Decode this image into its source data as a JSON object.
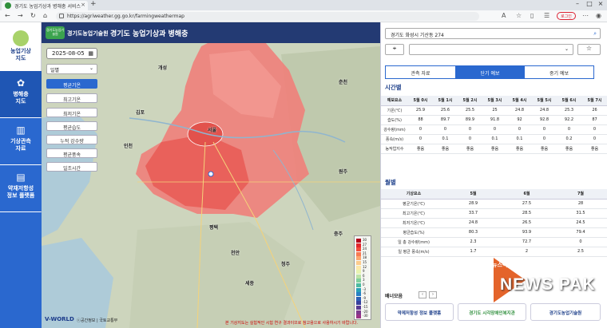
{
  "browser": {
    "tab_title": "경기도 농업기상과 병해충 서비스",
    "url": "https://agriweather.gg.go.kr/farmingweathermap",
    "profile_label": "로그인"
  },
  "leftnav": {
    "logo_label": "농업기상\n지도",
    "items": [
      {
        "label": "병해충\n지도",
        "icon": "bug-icon"
      },
      {
        "label": "기상관측\n자료",
        "icon": "chart-icon"
      },
      {
        "label": "약재저항성\n정보 플랫폼",
        "icon": "device-icon"
      }
    ]
  },
  "map": {
    "header_org": "경기도농업기술원",
    "header_title": "경기도 농업기상과 병해충",
    "badge_text": "경기도농업기술원",
    "date": "2025-08-05",
    "select_value": "일별",
    "variables": [
      "평균기온",
      "최고기온",
      "최저기온",
      "평균습도",
      "누적 강수량",
      "평균풍속",
      "일조시간"
    ],
    "active_variable": 0,
    "places": [
      "개성",
      "김포",
      "서울",
      "인천",
      "평택",
      "천안",
      "세종",
      "춘천",
      "원주",
      "충주",
      "청주"
    ],
    "legend": {
      "values": [
        "30",
        "27",
        "24",
        "21",
        "18",
        "15",
        "12",
        "9",
        "6",
        "3",
        "0",
        "-3",
        "-6",
        "-9",
        "-12",
        "-15",
        "-20",
        "-30"
      ],
      "colors": [
        "#b3001b",
        "#e3262d",
        "#f24d3c",
        "#f87a53",
        "#fda66f",
        "#fecc8c",
        "#fee8a8",
        "#e8f3b0",
        "#bde3a6",
        "#82cf9e",
        "#4dbba0",
        "#2aa1b7",
        "#2881c4",
        "#2e60b5",
        "#37409e",
        "#5a3b92",
        "#7c3a8d",
        "#9a3286"
      ]
    },
    "logo": "V-WORLD",
    "copyright": "ⓒ공간정보 | 국토교통부",
    "disclaimer": "본 기상지도는 실험적인 시험 연구 결과이므로 참고용으로 사용하시기 바랍니다."
  },
  "panel": {
    "search_value": "경기도 화성시 기산동 274",
    "tabs": [
      "관측 자료",
      "단기 예보",
      "중기 예보"
    ],
    "active_tab": 1,
    "hourly": {
      "title": "시간별",
      "columns": [
        "예보요소",
        "5월 0시",
        "5월 1시",
        "5월 2시",
        "5월 3시",
        "5월 4시",
        "5월 5시",
        "5월 6시",
        "5월 7시"
      ],
      "rows": [
        [
          "기온(℃)",
          "25.9",
          "25.6",
          "25.5",
          "25",
          "24.8",
          "24.8",
          "25.3",
          "26"
        ],
        [
          "습도(%)",
          "88",
          "89.7",
          "89.9",
          "91.8",
          "92",
          "92.8",
          "92.2",
          "87"
        ],
        [
          "강수량(mm)",
          "0",
          "0",
          "0",
          "0",
          "0",
          "0",
          "0",
          "0"
        ],
        [
          "풍속(m/s)",
          "0",
          "0.1",
          "0",
          "0.1",
          "0.1",
          "0",
          "0.2",
          "0"
        ],
        [
          "농작업지수",
          "좋음",
          "좋음",
          "좋음",
          "좋음",
          "좋음",
          "좋음",
          "좋음",
          "좋음"
        ]
      ]
    },
    "monthly": {
      "title": "월별",
      "columns": [
        "기상요소",
        "5월",
        "6월",
        "7월"
      ],
      "rows": [
        [
          "평균기온(℃)",
          "28.9",
          "27.5",
          "28"
        ],
        [
          "최고기온(℃)",
          "33.7",
          "28.5",
          "31.5"
        ],
        [
          "최저기온(℃)",
          "24.8",
          "26.5",
          "24.5"
        ],
        [
          "평균습도(%)",
          "80.3",
          "93.9",
          "79.4"
        ],
        [
          "일 총 강수량(mm)",
          "2.3",
          "72.7",
          "0"
        ],
        [
          "일 평균 풍속(m/s)",
          "1.7",
          "2",
          "2.5"
        ]
      ]
    },
    "banners_title": "배너모음",
    "banners": [
      "약제저항성 정보 플랫폼",
      "경기도 시각장애인복지관",
      "경기도농업기술원"
    ]
  },
  "watermark": {
    "small": "뉴스팩",
    "big": "NEWS PAK"
  }
}
